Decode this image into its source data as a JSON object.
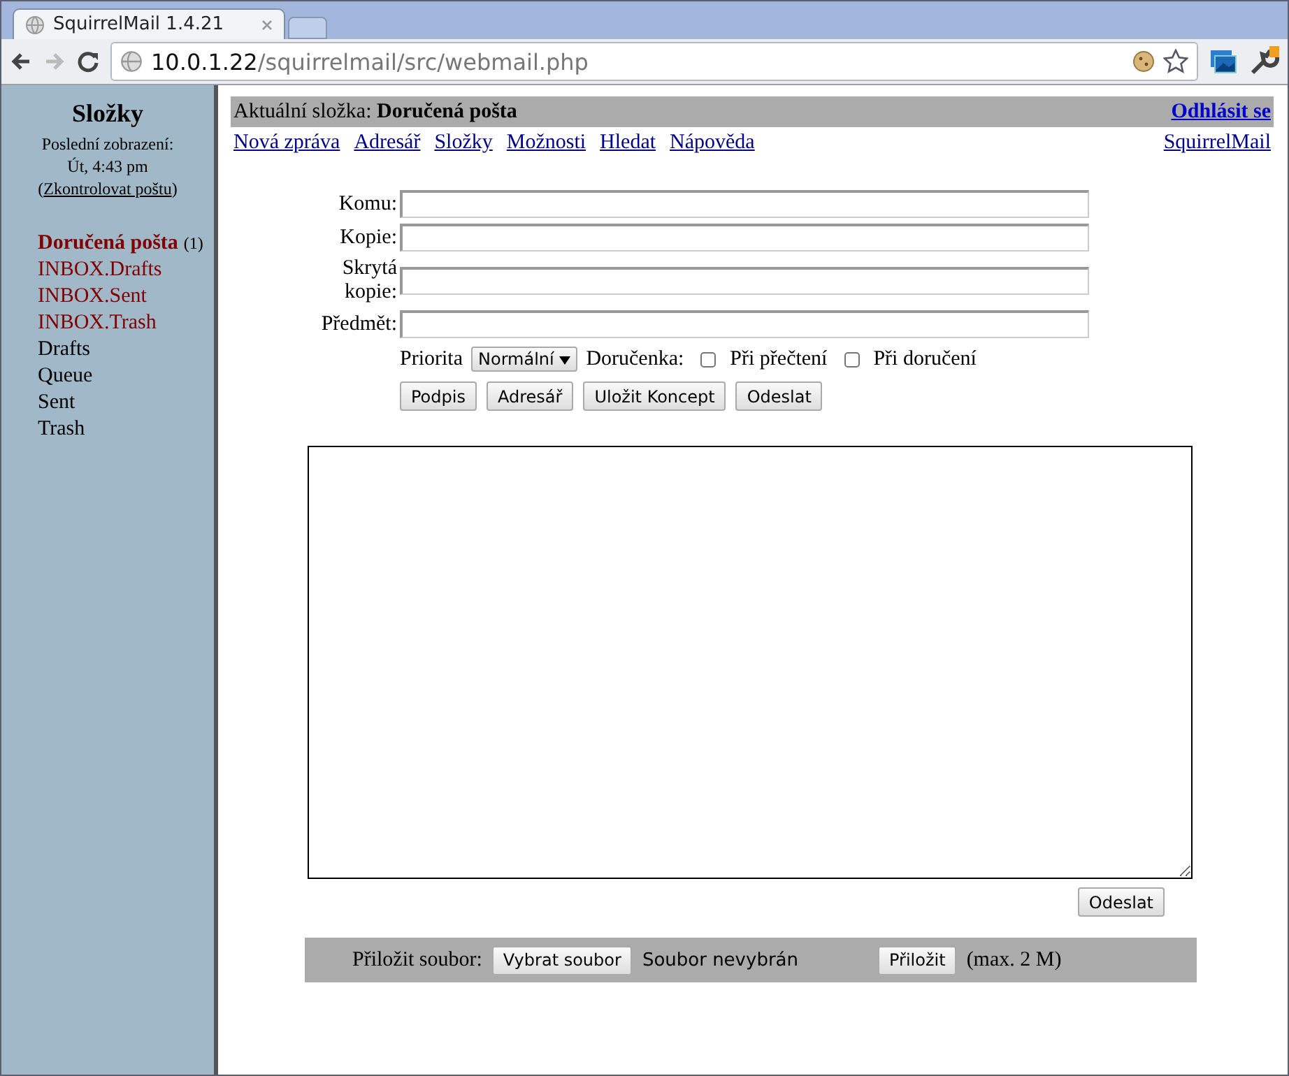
{
  "browser": {
    "tabs": [
      {
        "title": "SquirrelMail 1.4.21",
        "selected": true
      }
    ],
    "url_host": "10.0.1.22",
    "url_path": "/squirrelmail/src/webmail.php"
  },
  "sidebar": {
    "title": "Složky",
    "last_refresh_label": "Poslední zobrazení:",
    "last_refresh_time": "Út, 4:43 pm",
    "check_open": "(",
    "check_link": "Zkontrolovat poštu",
    "check_close": ")",
    "folders": [
      {
        "name": "Doručená pošta",
        "count": "(1)",
        "selected": true,
        "color": "#800000"
      },
      {
        "name": "INBOX.Drafts",
        "selected": false,
        "color": "#800000"
      },
      {
        "name": "INBOX.Sent",
        "selected": false,
        "color": "#800000"
      },
      {
        "name": "INBOX.Trash",
        "selected": false,
        "color": "#800000"
      },
      {
        "name": "Drafts",
        "selected": false,
        "color": "#000000"
      },
      {
        "name": "Queue",
        "selected": false,
        "color": "#000000"
      },
      {
        "name": "Sent",
        "selected": false,
        "color": "#000000"
      },
      {
        "name": "Trash",
        "selected": false,
        "color": "#000000"
      }
    ]
  },
  "header": {
    "folder_label": "Aktuální složka:",
    "folder_name": "Doručená pošta",
    "logout": "Odhlásit se",
    "menu": [
      "Nová zpráva",
      "Adresář",
      "Složky",
      "Možnosti",
      "Hledat",
      "Nápověda"
    ],
    "brand_link": "SquirrelMail"
  },
  "compose": {
    "fields": [
      {
        "label": "Komu:"
      },
      {
        "label": "Kopie:"
      },
      {
        "label": "Skrytá kopie:"
      },
      {
        "label": "Předmět:"
      }
    ],
    "priority_label": "Priorita",
    "priority_value": "Normální",
    "receipt_label": "Doručenka:",
    "receipts": [
      {
        "label": "Při přečtení",
        "checked": false
      },
      {
        "label": "Při doručení",
        "checked": false
      }
    ],
    "buttons": [
      "Podpis",
      "Adresář",
      "Uložit Koncept",
      "Odeslat"
    ],
    "send_button": "Odeslat"
  },
  "attach": {
    "label": "Přiložit soubor:",
    "choose_button": "Vybrat soubor",
    "no_file": "Soubor nevybrán",
    "attach_button": "Přiložit",
    "max_note": "(max. 2 M)"
  }
}
